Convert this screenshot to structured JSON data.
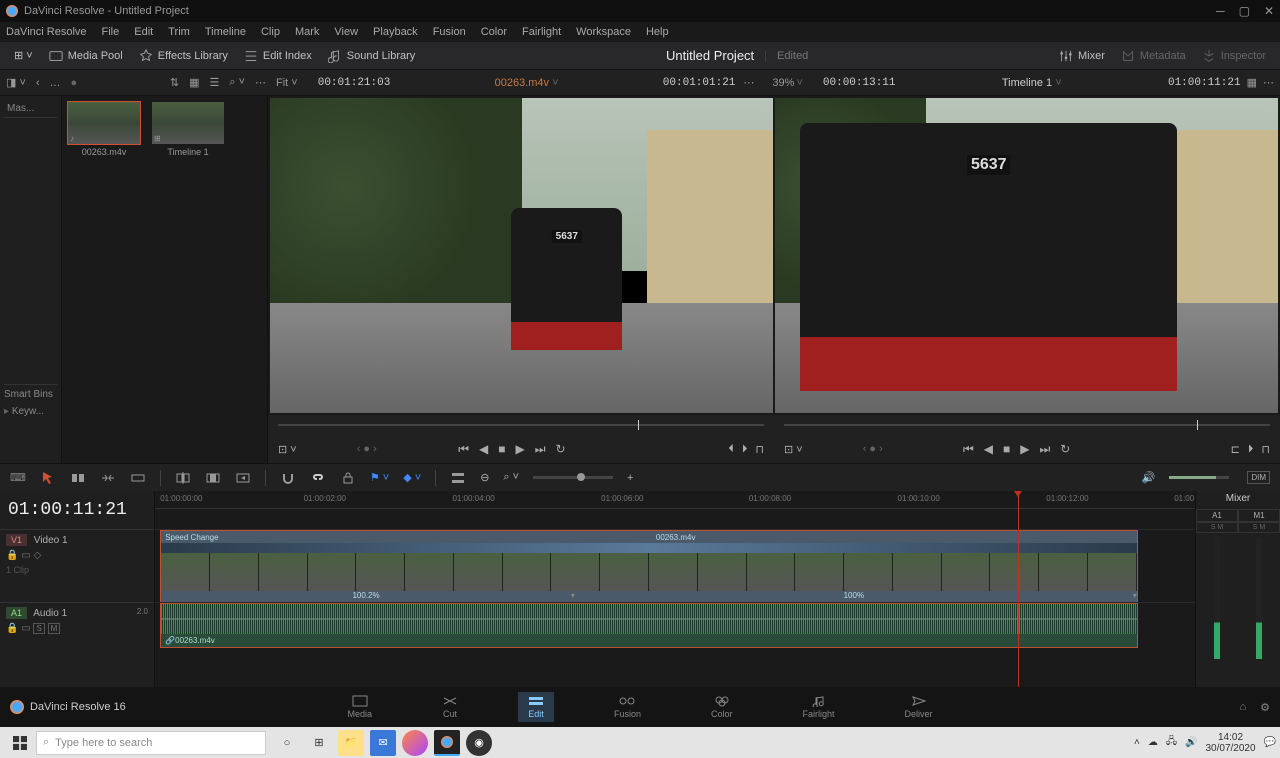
{
  "window": {
    "title": "DaVinci Resolve - Untitled Project"
  },
  "menu": [
    "DaVinci Resolve",
    "File",
    "Edit",
    "Trim",
    "Timeline",
    "Clip",
    "Mark",
    "View",
    "Playback",
    "Fusion",
    "Color",
    "Fairlight",
    "Workspace",
    "Help"
  ],
  "top_toolbar": {
    "media_pool": "Media Pool",
    "effects": "Effects Library",
    "edit_index": "Edit Index",
    "sound": "Sound Library",
    "project": "Untitled Project",
    "edited": "Edited",
    "mixer": "Mixer",
    "metadata": "Metadata",
    "inspector": "Inspector"
  },
  "sub_toolbar": {
    "fit": "Fit",
    "src_tc": "00:01:21:03",
    "src_name": "00263.m4v",
    "src_dur": "00:01:01:21",
    "zoom": "39%",
    "prog_dur": "00:00:13:11",
    "timeline_name": "Timeline 1",
    "prog_tc": "01:00:11:21"
  },
  "left_panel": {
    "master": "Mas...",
    "smart_bins": "Smart Bins",
    "keywords": "Keyw..."
  },
  "media": {
    "clip1": "00263.m4v",
    "clip2": "Timeline 1"
  },
  "viewer": {
    "loco_number": "5637"
  },
  "timeline": {
    "current_tc": "01:00:11:21",
    "ruler": [
      "01:00:00:00",
      "01:00:02:00",
      "01:00:04:00",
      "01:00:06:00",
      "01:00:08:00",
      "01:00:10:00",
      "01:00:12:00",
      "01:00"
    ],
    "video_track": {
      "badge": "V1",
      "name": "Video 1",
      "clips": "1 Clip"
    },
    "audio_track": {
      "badge": "A1",
      "name": "Audio 1",
      "gain": "2.0"
    },
    "clip": {
      "speed_label": "Speed Change",
      "name": "00263.m4v",
      "speed1": "100.2%",
      "speed2": "100%",
      "audio_name": "00263.m4v"
    },
    "mixer_title": "Mixer",
    "mixer_ch1": "A1",
    "mixer_ch2": "M1"
  },
  "bottom_nav": {
    "app": "DaVinci Resolve 16",
    "items": [
      "Media",
      "Cut",
      "Edit",
      "Fusion",
      "Color",
      "Fairlight",
      "Deliver"
    ]
  },
  "taskbar": {
    "search": "Type here to search",
    "time": "14:02",
    "date": "30/07/2020"
  }
}
